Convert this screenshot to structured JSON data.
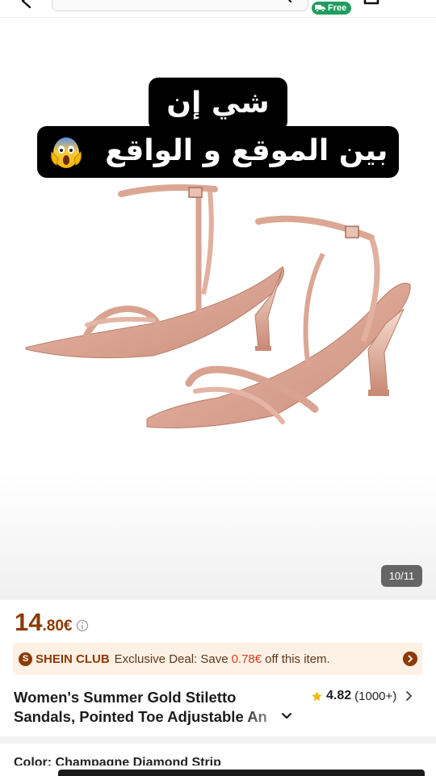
{
  "header": {
    "shipping_badge": "Free",
    "icons": [
      "back-arrow-icon",
      "search-icon",
      "truck-icon",
      "shopping-bag-icon"
    ]
  },
  "gallery": {
    "caption_line1": "شي إن",
    "caption_line2": "بين الموقع و الواقع",
    "caption_emoji": "face-screaming-in-fear",
    "counter": "10/11"
  },
  "price": {
    "integer": "14",
    "decimal": ".80€"
  },
  "club": {
    "badge": "S",
    "name": "SHEIN CLUB",
    "text_before": "Exclusive Deal: Save",
    "amount": "0.78€",
    "text_after": "off this item."
  },
  "product": {
    "title_line1": "Women's Summer Gold Stiletto",
    "title_line2": "Sandals, Pointed Toe Adjustable An"
  },
  "rating": {
    "value": "4.82",
    "count": "(1000+)"
  },
  "attributes": {
    "color_row": "Color: Champagne Diamond Strip"
  },
  "colors": {
    "price": "#8c3a06",
    "club_bg": "#fdf0e4",
    "save_amount": "#e03a1e",
    "free_badge": "#1e9e5e",
    "star": "#f6b900"
  }
}
